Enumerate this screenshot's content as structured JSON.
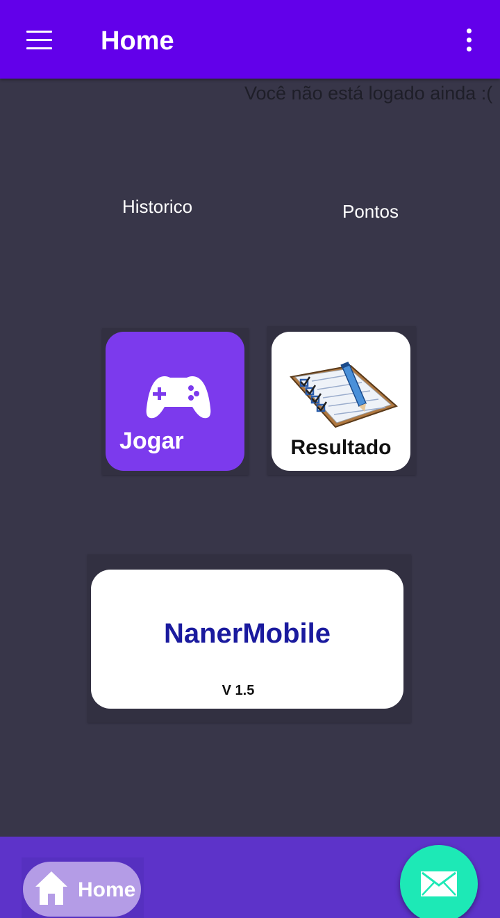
{
  "app_bar": {
    "title": "Home",
    "menu_icon": "menu-icon",
    "overflow_icon": "more-vert-icon",
    "color": "#6200ea"
  },
  "status": {
    "login_message": "Você não está logado ainda :("
  },
  "links": {
    "historico": "Historico",
    "pontos": "Pontos"
  },
  "tiles": {
    "jogar": {
      "label": "Jogar",
      "icon": "gamepad-icon",
      "color": "#7c3aed"
    },
    "resultado": {
      "label": "Resultado",
      "icon": "clipboard-checklist-icon"
    }
  },
  "banner": {
    "app_name": "NanerMobile",
    "version": "V 1.5",
    "name_color": "#1a1a9e"
  },
  "bottom_bar": {
    "home_label": "Home",
    "home_icon": "home-icon",
    "fab_icon": "mail-icon",
    "fab_color": "#1de9b6"
  }
}
